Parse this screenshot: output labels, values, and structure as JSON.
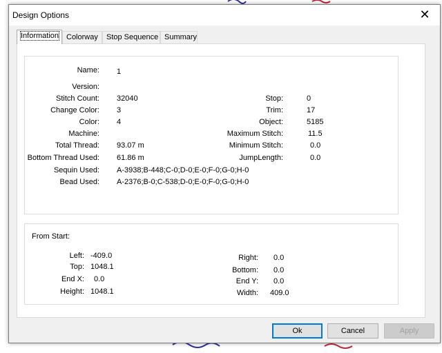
{
  "window": {
    "title": "Design Options",
    "close_glyph": "✕"
  },
  "tabs": [
    {
      "label": "Information",
      "active": true
    },
    {
      "label": "Colorway",
      "active": false
    },
    {
      "label": "Stop Sequence",
      "active": false
    },
    {
      "label": "Summary",
      "active": false
    }
  ],
  "info": {
    "name": {
      "label": "Name:",
      "value": "1"
    },
    "version": {
      "label": "Version:",
      "value": ""
    },
    "stitch_count": {
      "label": "Stitch Count:",
      "value": "32040"
    },
    "change_color": {
      "label": "Change Color:",
      "value": "3"
    },
    "color": {
      "label": "Color:",
      "value": "4"
    },
    "machine": {
      "label": "Machine:",
      "value": ""
    },
    "total_thread": {
      "label": "Total Thread:",
      "value": "93.07 m"
    },
    "bottom_thread": {
      "label": "Bottom Thread Used:",
      "value": "61.86 m"
    },
    "sequin_used": {
      "label": "Sequin Used:",
      "value": "A-3938;B-448;C-0;D-0;E-0;F-0;G-0;H-0"
    },
    "bead_used": {
      "label": "Bead Used:",
      "value": "A-2376;B-0;C-538;D-0;E-0;F-0;G-0;H-0"
    },
    "stop": {
      "label": "Stop:",
      "value": "0"
    },
    "trim": {
      "label": "Trim:",
      "value": "17"
    },
    "object": {
      "label": "Object:",
      "value": "5185"
    },
    "max_stitch": {
      "label": "Maximum Stitch:",
      "value": "11.5"
    },
    "min_stitch": {
      "label": "Minimum Stitch:",
      "value": "0.0"
    },
    "jump_length": {
      "label": "JumpLength:",
      "value": "0.0"
    }
  },
  "from_start": {
    "title": "From Start:",
    "left": {
      "label": "Left:",
      "value": "-409.0"
    },
    "top": {
      "label": "Top:",
      "value": "1048.1"
    },
    "end_x": {
      "label": "End X:",
      "value": "0.0"
    },
    "height": {
      "label": "Height:",
      "value": "1048.1"
    },
    "right": {
      "label": "Right:",
      "value": "0.0"
    },
    "bottom": {
      "label": "Bottom:",
      "value": "0.0"
    },
    "end_y": {
      "label": "End Y:",
      "value": "0.0"
    },
    "width": {
      "label": "Width:",
      "value": "409.0"
    }
  },
  "buttons": {
    "ok": "Ok",
    "cancel": "Cancel",
    "apply": "Apply"
  },
  "colors": {
    "accent": "#0078d7",
    "art_blue": "#2b2f9e",
    "art_red": "#c0283a"
  }
}
